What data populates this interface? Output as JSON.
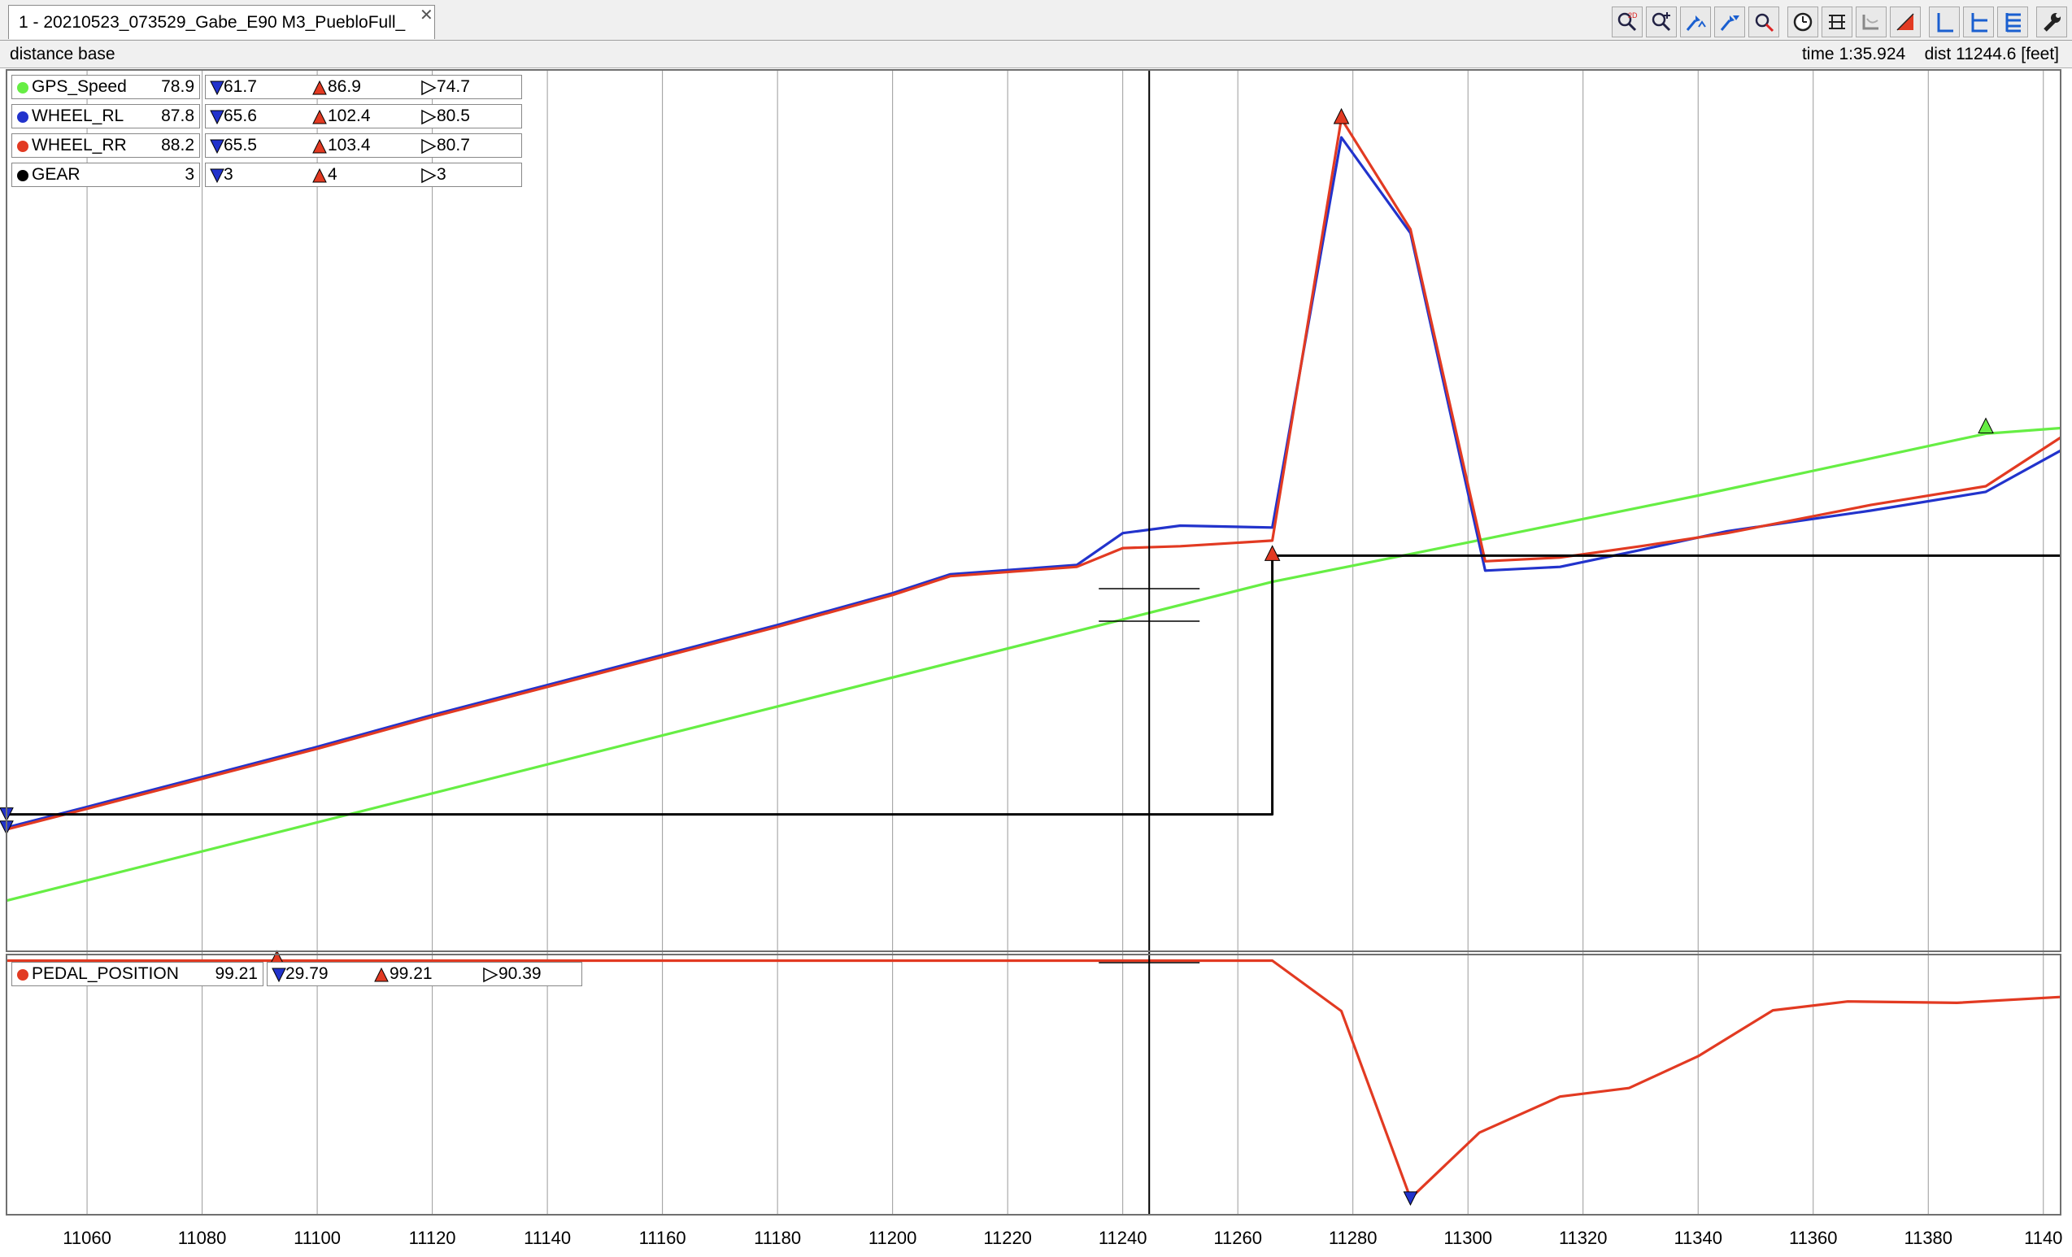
{
  "window": {
    "tab_title": "1 - 20210523_073529_Gabe_E90 M3_PuebloFull_",
    "tab_close_icon": "close-icon"
  },
  "toolbar": {
    "buttons": [
      {
        "name": "zoom-2d-button",
        "icon": "magnifier-2d-icon"
      },
      {
        "name": "zoom-in-button",
        "icon": "magnifier-plus-icon"
      },
      {
        "name": "zoom-range-button",
        "icon": "zoom-range-icon"
      },
      {
        "name": "zoom-marker-button",
        "icon": "zoom-marker-icon"
      },
      {
        "name": "zoom-reset-button",
        "icon": "magnifier-icon"
      },
      {
        "name": "time-base-button",
        "icon": "clock-icon"
      },
      {
        "name": "distance-base-button",
        "icon": "distance-icon"
      },
      {
        "name": "overlay-button",
        "icon": "overlay-icon"
      },
      {
        "name": "min-max-button",
        "icon": "min-max-icon"
      },
      {
        "name": "layout-single-button",
        "icon": "layout-single-icon"
      },
      {
        "name": "layout-split-button",
        "icon": "layout-split-icon"
      },
      {
        "name": "layout-stacked-button",
        "icon": "layout-stacked-icon"
      },
      {
        "name": "properties-button",
        "icon": "wrench-icon"
      }
    ]
  },
  "info_bar": {
    "mode": "distance base",
    "time_label": "time",
    "time_value": "1:35.924",
    "dist_label": "dist",
    "dist_value": "11244.6",
    "dist_unit": "[feet]"
  },
  "colors": {
    "gps_speed": "#66ee44",
    "wheel_rl": "#2233cc",
    "wheel_rr": "#e23a22",
    "gear": "#000000",
    "pedal": "#e23a22",
    "min_marker": "#2233cc",
    "max_marker": "#e23a22"
  },
  "legend_top": [
    {
      "name": "GPS_Speed",
      "value": "78.9",
      "min": "61.7",
      "max": "86.9",
      "avg": "74.7"
    },
    {
      "name": "WHEEL_RL",
      "value": "87.8",
      "min": "65.6",
      "max": "102.4",
      "avg": "80.5"
    },
    {
      "name": "WHEEL_RR",
      "value": "88.2",
      "min": "65.5",
      "max": "103.4",
      "avg": "80.7"
    },
    {
      "name": "GEAR",
      "value": "3",
      "min": "3",
      "max": "4",
      "avg": "3"
    }
  ],
  "legend_bottom": [
    {
      "name": "PEDAL_POSITION",
      "value": "99.21",
      "min": "29.79",
      "max": "99.21",
      "avg": "90.39"
    }
  ],
  "chart_data": {
    "type": "line",
    "xlabel": "",
    "ylabel": "",
    "x_unit": "feet",
    "xlim": [
      11046,
      11403
    ],
    "x_ticks": [
      11060,
      11080,
      11100,
      11120,
      11140,
      11160,
      11180,
      11200,
      11220,
      11240,
      11260,
      11280,
      11300,
      11320,
      11340,
      11360,
      11380,
      11400
    ],
    "x_tick_labels": [
      "11060",
      "11080",
      "11100",
      "11120",
      "11140",
      "11160",
      "11180",
      "11200",
      "11220",
      "11240",
      "11260",
      "11280",
      "11300",
      "11320",
      "11340",
      "11360",
      "11380",
      "1140"
    ],
    "cursor_x": 11244.6,
    "grid": true,
    "legend_placement": "top-left",
    "panes": [
      {
        "name": "top",
        "ylim": [
          59,
          106
        ],
        "series": [
          {
            "name": "GPS_Speed",
            "x": [
              11046,
              11266,
              11300,
              11340,
              11390,
              11403
            ],
            "y": [
              61.7,
              78.7,
              80.8,
              83.3,
              86.6,
              86.9
            ]
          },
          {
            "name": "WHEEL_RL",
            "x": [
              11046,
              11060,
              11080,
              11100,
              11120,
              11140,
              11160,
              11180,
              11200,
              11210,
              11232,
              11240,
              11250,
              11266,
              11278,
              11290,
              11303,
              11316,
              11330,
              11345,
              11370,
              11390,
              11403
            ],
            "y": [
              65.6,
              66.7,
              68.3,
              69.9,
              71.6,
              73.2,
              74.8,
              76.4,
              78.1,
              79.1,
              79.6,
              81.3,
              81.7,
              81.6,
              102.4,
              97.3,
              79.3,
              79.5,
              80.4,
              81.4,
              82.5,
              83.5,
              85.7
            ]
          },
          {
            "name": "WHEEL_RR",
            "x": [
              11046,
              11060,
              11080,
              11100,
              11120,
              11140,
              11160,
              11180,
              11200,
              11210,
              11232,
              11240,
              11250,
              11266,
              11278,
              11290,
              11303,
              11316,
              11330,
              11345,
              11370,
              11390,
              11403
            ],
            "y": [
              65.5,
              66.6,
              68.2,
              69.8,
              71.5,
              73.1,
              74.7,
              76.3,
              78.0,
              79.0,
              79.5,
              80.5,
              80.6,
              80.9,
              103.4,
              97.5,
              79.8,
              80.0,
              80.6,
              81.3,
              82.8,
              83.8,
              86.4
            ]
          },
          {
            "name": "GEAR",
            "x": [
              11046,
              11266,
              11266,
              11403
            ],
            "y": [
              3,
              3,
              4,
              4
            ],
            "gear_scale": {
              "3": 66.3,
              "4": 80.1
            }
          }
        ],
        "markers": [
          {
            "series": "WHEEL_RL",
            "type": "min",
            "x": 11046,
            "y": 65.6
          },
          {
            "series": "WHEEL_RR",
            "type": "max",
            "x": 11278,
            "y": 103.4
          },
          {
            "series": "GEAR",
            "type": "min",
            "x": 11046,
            "y": 3
          },
          {
            "series": "GEAR",
            "type": "max",
            "x": 11266,
            "y": 4
          },
          {
            "series": "GPS_Speed",
            "type": "max",
            "x": 11390,
            "y": 86.9
          }
        ]
      },
      {
        "name": "bottom",
        "ylim": [
          25,
          101
        ],
        "series": [
          {
            "name": "PEDAL_POSITION",
            "x": [
              11046,
              11266,
              11278,
              11290,
              11302,
              11316,
              11328,
              11340,
              11353,
              11366,
              11385,
              11403
            ],
            "y": [
              99.21,
              99.21,
              84.5,
              29.79,
              49.0,
              59.5,
              62.0,
              71.3,
              84.7,
              87.3,
              86.9,
              88.6
            ]
          }
        ],
        "markers": [
          {
            "series": "PEDAL_POSITION",
            "type": "min",
            "x": 11290,
            "y": 29.79
          },
          {
            "series": "PEDAL_POSITION",
            "type": "max",
            "x": 11093,
            "y": 99.21
          }
        ]
      }
    ]
  }
}
